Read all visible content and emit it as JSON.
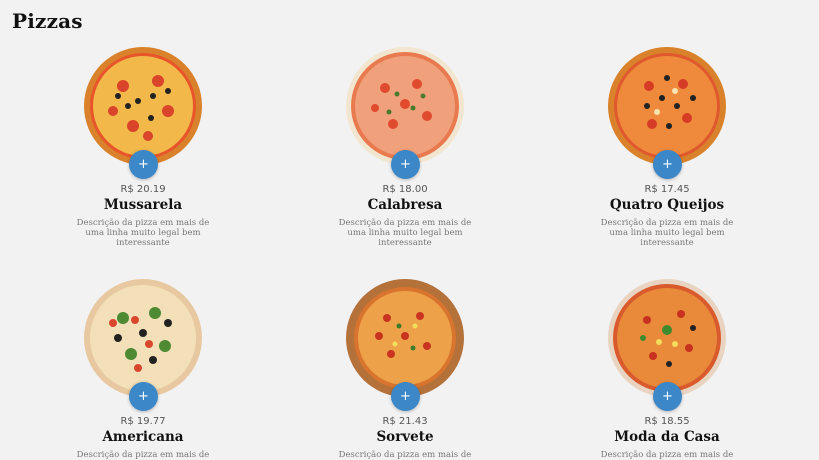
{
  "page": {
    "title": "Pizzas"
  },
  "pizzas": [
    {
      "price": "R$ 20.19",
      "name": "Mussarela",
      "description": "Descrição da pizza em mais de uma linha muito legal bem interessante",
      "add_label": "+"
    },
    {
      "price": "R$ 18.00",
      "name": "Calabresa",
      "description": "Descrição da pizza em mais de uma linha muito legal bem interessante",
      "add_label": "+"
    },
    {
      "price": "R$ 17.45",
      "name": "Quatro Queijos",
      "description": "Descrição da pizza em mais de uma linha muito legal bem interessante",
      "add_label": "+"
    },
    {
      "price": "R$ 19.77",
      "name": "Americana",
      "description": "Descrição da pizza em mais de",
      "add_label": "+"
    },
    {
      "price": "R$ 21.43",
      "name": "Sorvete",
      "description": "Descrição da pizza em mais de",
      "add_label": "+"
    },
    {
      "price": "R$ 18.55",
      "name": "Moda da Casa",
      "description": "Descrição da pizza em mais de",
      "add_label": "+"
    }
  ],
  "colors": {
    "background": "#f2f2f3",
    "add_button": "#3b87c8",
    "crust": "#d9822b",
    "sauce": "#e8552a",
    "cheese": "#f4c766"
  }
}
